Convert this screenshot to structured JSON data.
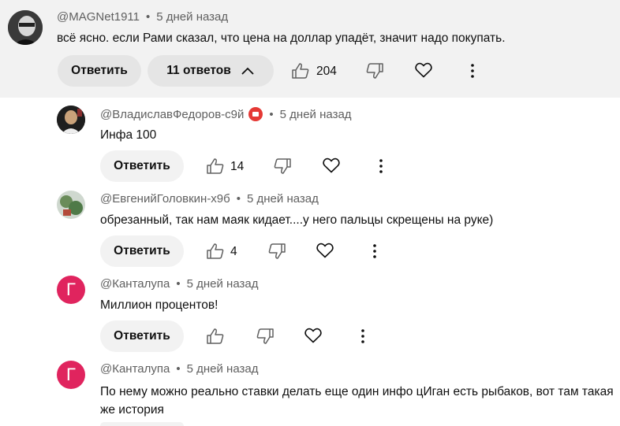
{
  "main": {
    "author": "@MAGNet1911",
    "time": "5 дней назад",
    "text": "всё ясно. если Рами сказал, что цена на доллар упадёт, значит надо покупать.",
    "reply_label": "Ответить",
    "replies_label": "11 ответов",
    "likes": "204"
  },
  "replies": [
    {
      "author": "@ВладиславФедоров-с9й",
      "time": "5 дней назад",
      "text": "Инфа 100",
      "reply_label": "Ответить",
      "likes": "14"
    },
    {
      "author": "@ЕвгенийГоловкин-х9б",
      "time": "5 дней назад",
      "text": "обрезанный, так нам маяк кидает....у него пальцы скрещены на руке)",
      "reply_label": "Ответить",
      "likes": "4"
    },
    {
      "author": "@Канталупа",
      "time": "5 дней назад",
      "text": "Миллион процентов!",
      "reply_label": "Ответить",
      "likes": "",
      "avatar_letter": "Г"
    },
    {
      "author": "@Канталупа",
      "time": "5 дней назад",
      "text": "По нему можно реально ставки делать еще один инфо цИган есть рыбаков, вот там такая же история",
      "avatar_letter": "Г"
    }
  ],
  "separator": "•",
  "colors": {
    "avatar_pink": "#e0245e",
    "main_bg": "#f2f2f2"
  },
  "icons": [
    "thumb-up-icon",
    "thumb-down-icon",
    "heart-icon",
    "more-vert-icon",
    "chevron-up-icon"
  ]
}
